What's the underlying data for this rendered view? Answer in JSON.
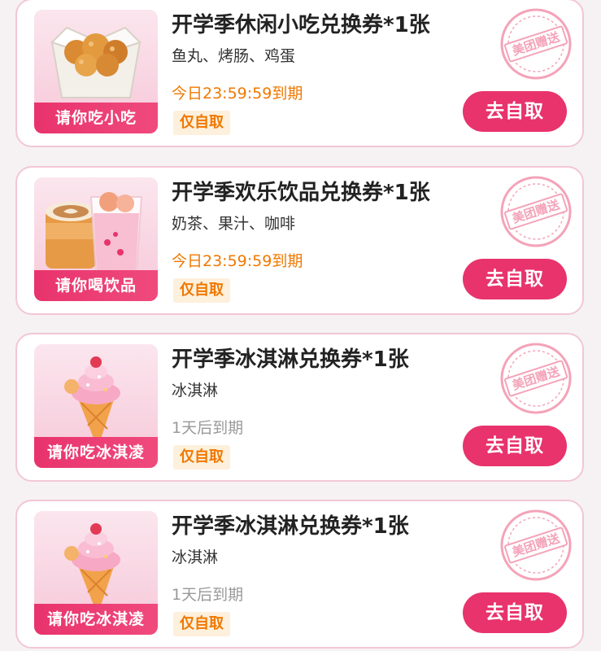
{
  "coupons": [
    {
      "title": "开学季休闲小吃兑换券*1张",
      "subtitle": "鱼丸、烤肠、鸡蛋",
      "expiry": "今日23:59:59到期",
      "expiry_color": "#f07800",
      "tag": "仅自取",
      "thumb_label": "请你吃小吃",
      "thumb_icon": "fried-snack-box-icon",
      "stamp": "美团赠送",
      "action": "去自取"
    },
    {
      "title": "开学季欢乐饮品兑换券*1张",
      "subtitle": "奶茶、果汁、咖啡",
      "expiry": "今日23:59:59到期",
      "expiry_color": "#f07800",
      "tag": "仅自取",
      "thumb_label": "请你喝饮品",
      "thumb_icon": "coffee-and-drink-cups-icon",
      "stamp": "美团赠送",
      "action": "去自取"
    },
    {
      "title": "开学季冰淇淋兑换券*1张",
      "subtitle": "冰淇淋",
      "expiry": "1天后到期",
      "expiry_color": "#999999",
      "tag": "仅自取",
      "thumb_label": "请你吃冰淇凌",
      "thumb_icon": "ice-cream-cone-icon",
      "stamp": "美团赠送",
      "action": "去自取"
    },
    {
      "title": "开学季冰淇淋兑换券*1张",
      "subtitle": "冰淇淋",
      "expiry": "1天后到期",
      "expiry_color": "#999999",
      "tag": "仅自取",
      "thumb_label": "请你吃冰淇凌",
      "thumb_icon": "ice-cream-cone-icon",
      "stamp": "美团赠送",
      "action": "去自取"
    }
  ],
  "colors": {
    "accent": "#e8336c",
    "card_border": "#f2c6d6",
    "tag_bg": "#fdf0dc",
    "tag_text": "#f07800",
    "stamp": "#f4a3b8"
  }
}
